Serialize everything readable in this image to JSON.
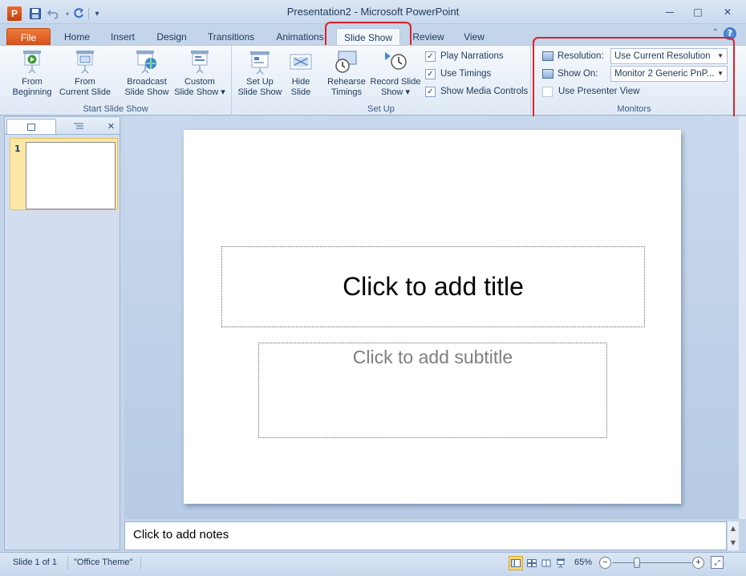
{
  "window": {
    "title": "Presentation2 - Microsoft PowerPoint",
    "app_icon_letter": "P",
    "controls": {
      "minimize": "—",
      "maximize": "□",
      "close": "✕"
    }
  },
  "quick_access": {
    "icons": [
      "save-icon",
      "undo-icon",
      "redo-icon",
      "customize-icon"
    ]
  },
  "tabs": [
    {
      "label": "File"
    },
    {
      "label": "Home"
    },
    {
      "label": "Insert"
    },
    {
      "label": "Design"
    },
    {
      "label": "Transitions"
    },
    {
      "label": "Animations"
    },
    {
      "label": "Slide Show"
    },
    {
      "label": "Review"
    },
    {
      "label": "View"
    }
  ],
  "ribbon": {
    "start_group": {
      "label": "Start Slide Show",
      "buttons": [
        {
          "line1": "From",
          "line2": "Beginning"
        },
        {
          "line1": "From",
          "line2": "Current Slide"
        },
        {
          "line1": "Broadcast",
          "line2": "Slide Show"
        },
        {
          "line1": "Custom",
          "line2": "Slide Show ▾"
        }
      ]
    },
    "setup_group": {
      "label": "Set Up",
      "buttons": [
        {
          "line1": "Set Up",
          "line2": "Slide Show"
        },
        {
          "line1": "Hide",
          "line2": "Slide"
        },
        {
          "line1": "Rehearse",
          "line2": "Timings"
        },
        {
          "line1": "Record Slide",
          "line2": "Show ▾"
        }
      ],
      "checkboxes": [
        {
          "label": "Play Narrations",
          "checked": "✓"
        },
        {
          "label": "Use Timings",
          "checked": "✓"
        },
        {
          "label": "Show Media Controls",
          "checked": "✓"
        }
      ]
    },
    "monitors_group": {
      "label": "Monitors",
      "resolution_label": "Resolution:",
      "resolution_value": "Use Current Resolution",
      "show_on_label": "Show On:",
      "show_on_value": "Monitor 2 Generic PnP...",
      "presenter_view_label": "Use Presenter View",
      "presenter_view_checked": ""
    }
  },
  "slides_pane": {
    "close": "✕",
    "thumbnails": [
      {
        "number": "1"
      }
    ]
  },
  "slide": {
    "title_placeholder": "Click to add title",
    "subtitle_placeholder": "Click to add subtitle"
  },
  "notes": {
    "placeholder": "Click to add notes"
  },
  "status_bar": {
    "slide_counter": "Slide 1 of 1",
    "theme": "\"Office Theme\"",
    "zoom": "65%",
    "zoom_out": "−",
    "zoom_in": "+"
  },
  "colors": {
    "file_tab": "#d9531c",
    "highlight_box": "#e0202a",
    "ribbon_bg": "#dfe9f5"
  }
}
